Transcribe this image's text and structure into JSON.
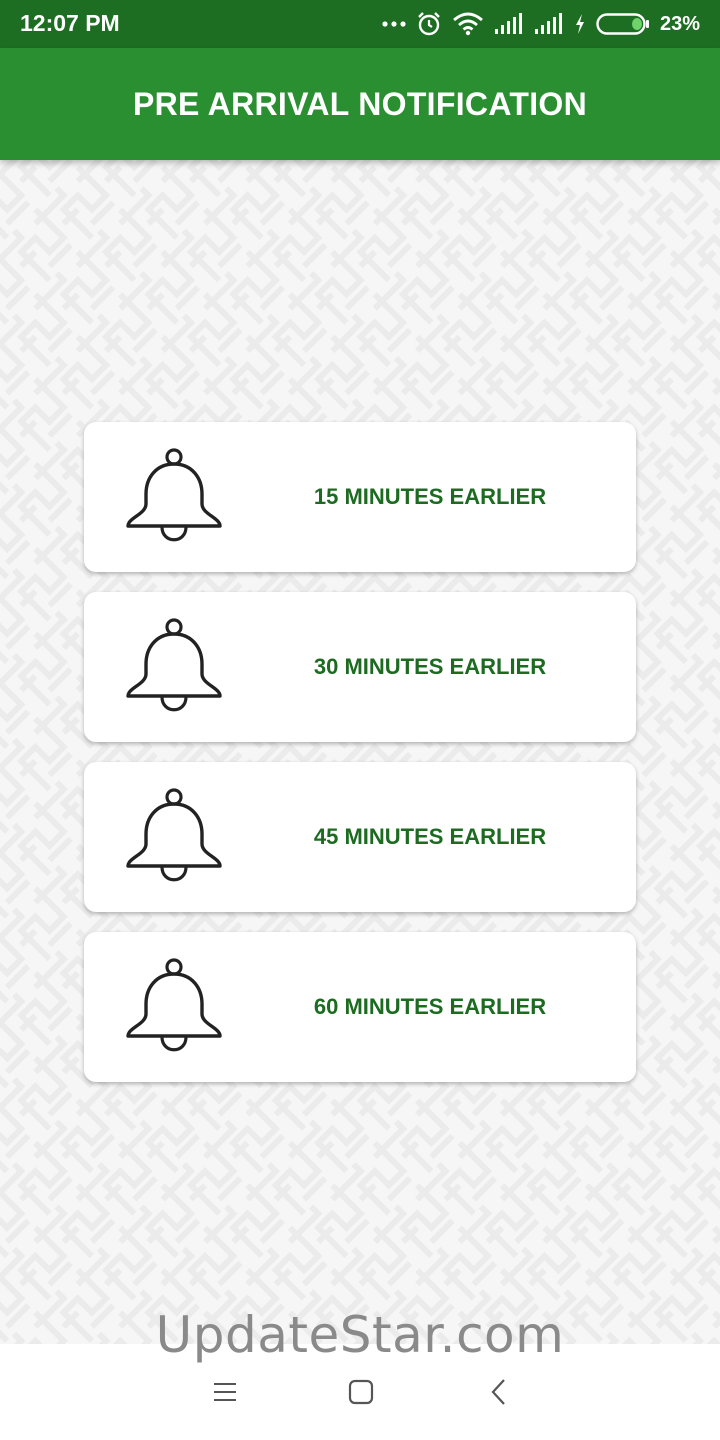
{
  "status_bar": {
    "time": "12:07 PM",
    "battery_percent": "23%",
    "battery_level": 0.23,
    "icons": [
      "more-dots-icon",
      "alarm-icon",
      "wifi-icon",
      "signal-icon",
      "signal-icon",
      "charging-icon",
      "battery-icon"
    ]
  },
  "app_bar": {
    "title": "PRE ARRIVAL NOTIFICATION"
  },
  "options": [
    {
      "label": "15 MINUTES EARLIER",
      "icon": "bell-icon"
    },
    {
      "label": "30 MINUTES EARLIER",
      "icon": "bell-icon"
    },
    {
      "label": "45 MINUTES EARLIER",
      "icon": "bell-icon"
    },
    {
      "label": "60 MINUTES EARLIER",
      "icon": "bell-icon"
    }
  ],
  "watermark": "UpdateStar.com",
  "nav_bar": {
    "icons": [
      "menu-icon",
      "home-square-icon",
      "back-chevron-icon"
    ]
  },
  "colors": {
    "status_bar": "#1d6e22",
    "app_bar": "#2a8f31",
    "label_text": "#1c6b21",
    "card": "#ffffff",
    "background": "#f6f6f6"
  }
}
